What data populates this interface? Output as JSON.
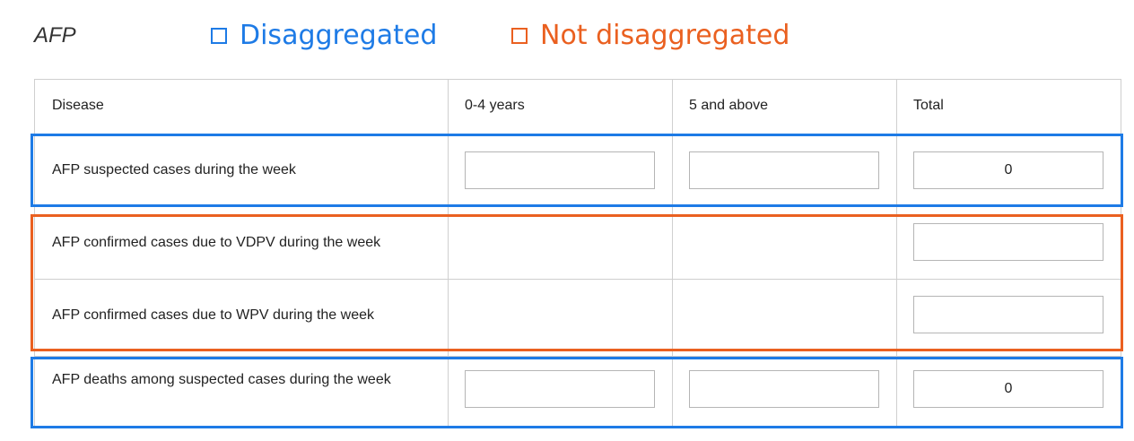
{
  "title": "AFP",
  "legend": {
    "disaggregated": "Disaggregated",
    "not_disaggregated": "Not disaggregated"
  },
  "colors": {
    "disaggregated": "#1e7be6",
    "not_disaggregated": "#ea6020"
  },
  "table": {
    "columns": [
      "Disease",
      "0-4 years",
      "5 and above",
      "Total"
    ],
    "rows": [
      {
        "label": "AFP suspected cases during the week",
        "total": "0",
        "group": "disaggregated"
      },
      {
        "label": "AFP confirmed cases due to VDPV during the week",
        "total": "",
        "group": "not_disaggregated"
      },
      {
        "label": "AFP confirmed cases due to WPV during the week",
        "total": "",
        "group": "not_disaggregated"
      },
      {
        "label": "AFP deaths among suspected cases during the week",
        "total": "0",
        "group": "disaggregated"
      }
    ]
  }
}
